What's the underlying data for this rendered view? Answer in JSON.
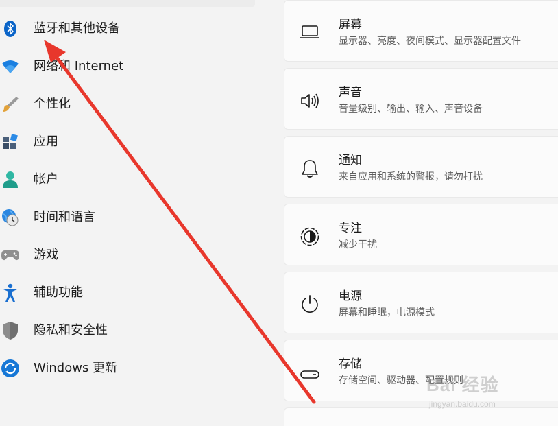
{
  "sidebar": {
    "items": [
      {
        "label": "蓝牙和其他设备",
        "icon": "bluetooth-icon"
      },
      {
        "label": "网络和 Internet",
        "icon": "wifi-icon"
      },
      {
        "label": "个性化",
        "icon": "brush-icon"
      },
      {
        "label": "应用",
        "icon": "apps-icon"
      },
      {
        "label": "帐户",
        "icon": "account-icon"
      },
      {
        "label": "时间和语言",
        "icon": "clock-globe-icon"
      },
      {
        "label": "游戏",
        "icon": "gamepad-icon"
      },
      {
        "label": "辅助功能",
        "icon": "accessibility-icon"
      },
      {
        "label": "隐私和安全性",
        "icon": "shield-icon"
      },
      {
        "label": "Windows 更新",
        "icon": "update-icon"
      }
    ]
  },
  "main": {
    "cards": [
      {
        "title": "屏幕",
        "desc": "显示器、亮度、夜间模式、显示器配置文件",
        "icon": "monitor-icon"
      },
      {
        "title": "声音",
        "desc": "音量级别、输出、输入、声音设备",
        "icon": "speaker-icon"
      },
      {
        "title": "通知",
        "desc": "来自应用和系统的警报，请勿打扰",
        "icon": "bell-icon"
      },
      {
        "title": "专注",
        "desc": "减少干扰",
        "icon": "focus-icon"
      },
      {
        "title": "电源",
        "desc": "屏幕和睡眠，电源模式",
        "icon": "power-icon"
      },
      {
        "title": "存储",
        "desc": "存储空间、驱动器、配置规则",
        "icon": "storage-icon"
      }
    ]
  },
  "watermark": {
    "main": "Bai 经验",
    "sub": "jingyan.baidu.com"
  },
  "colors": {
    "accent": "#0067c0",
    "arrow": "#e8372c",
    "background": "#f3f3f3",
    "card": "#fbfbfb"
  }
}
